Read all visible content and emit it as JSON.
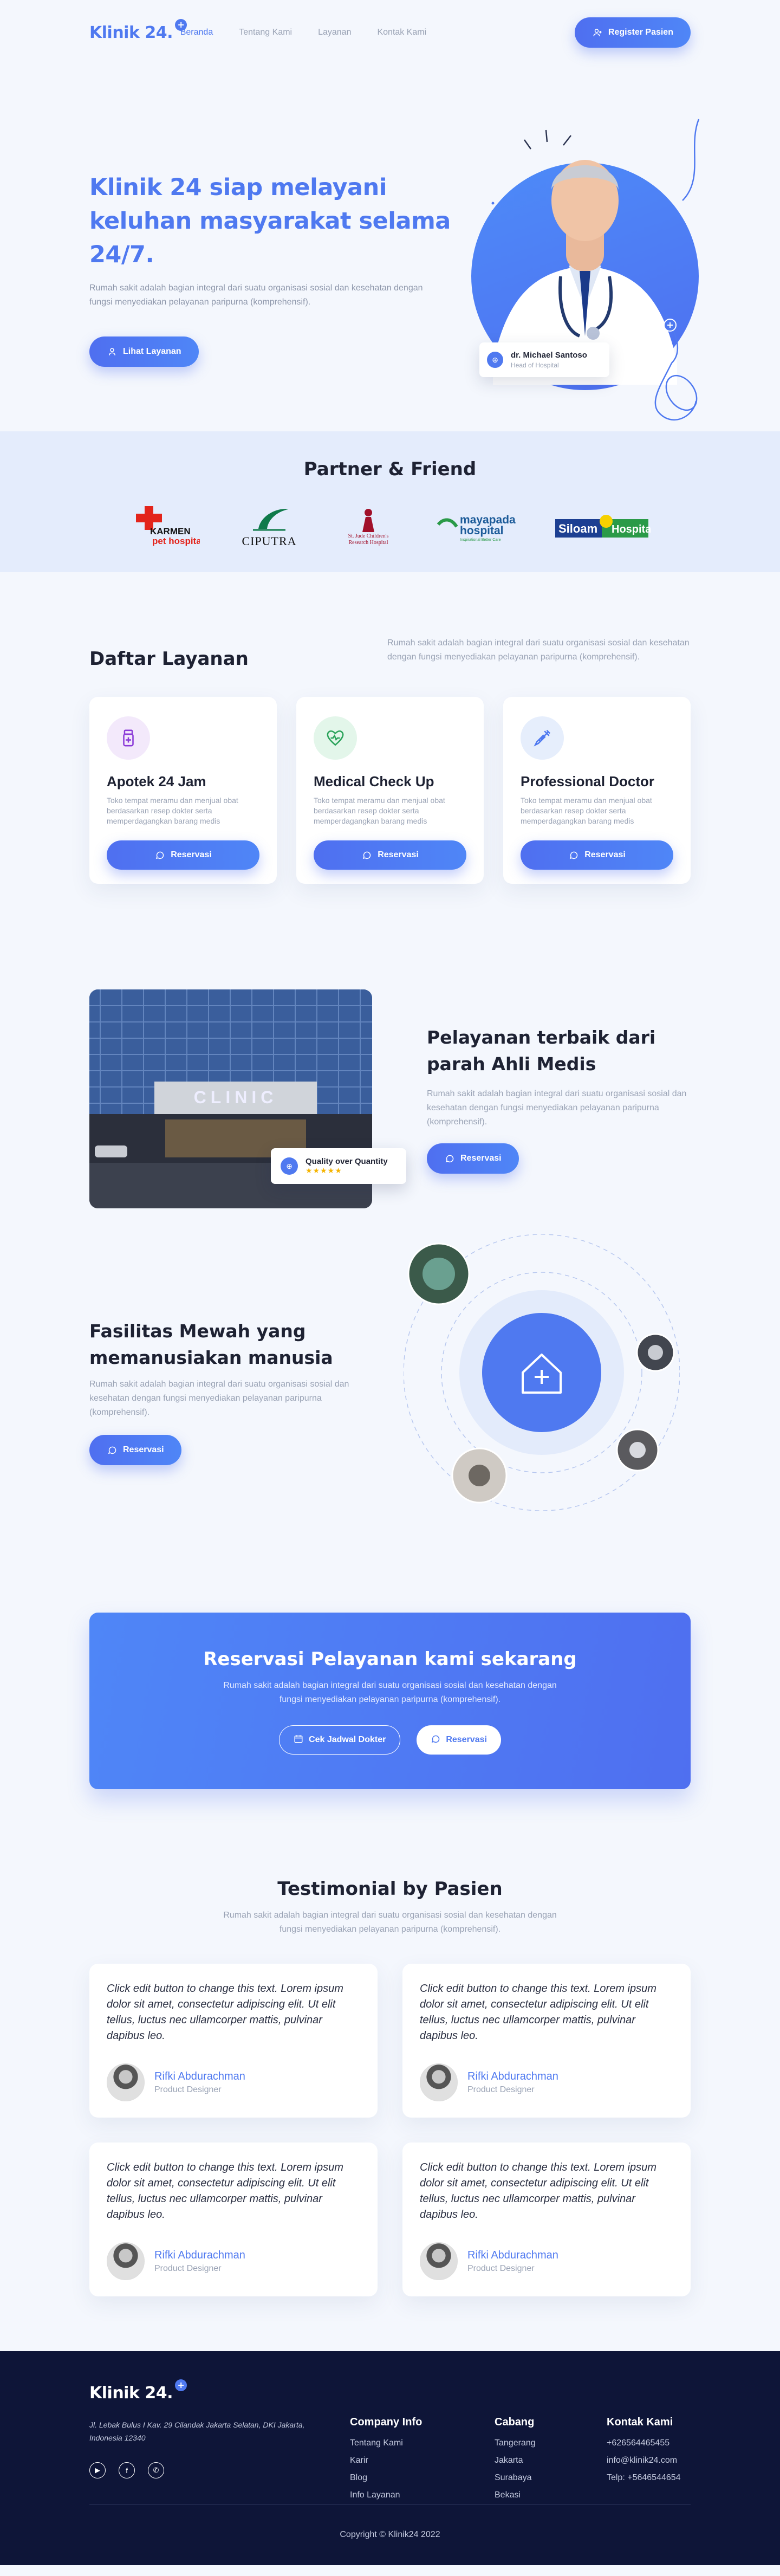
{
  "nav": {
    "logo": "Klinik 24.",
    "links": [
      "Beranda",
      "Tentang Kami",
      "Layanan",
      "Kontak Kami"
    ],
    "cta": "Register Pasien"
  },
  "hero": {
    "title": "Klinik 24 siap melayani keluhan masyarakat selama 24/7.",
    "desc": "Rumah sakit adalah bagian integral dari suatu organisasi sosial dan kesehatan dengan fungsi menyediakan pelayanan paripurna (komprehensif).",
    "cta": "Lihat Layanan",
    "doctor_name": "dr. Michael Santoso",
    "doctor_role": "Head of Hospital"
  },
  "partner": {
    "title": "Partner & Friend",
    "logos": [
      "KARMEN pet hospital",
      "CIPUTRA",
      "St. Jude Children's Research Hospital",
      "mayapada hospital",
      "Siloam Hospitals"
    ]
  },
  "services": {
    "title": "Daftar Layanan",
    "desc": "Rumah sakit adalah bagian integral dari suatu organisasi sosial dan kesehatan dengan fungsi menyediakan pelayanan paripurna (komprehensif).",
    "cards": [
      {
        "title": "Apotek 24 Jam",
        "desc": "Toko tempat meramu dan menjual obat berdasarkan resep dokter serta memperdagangkan barang medis",
        "button": "Reservasi"
      },
      {
        "title": "Medical Check Up",
        "desc": "Toko tempat meramu dan menjual obat berdasarkan resep dokter serta memperdagangkan barang medis",
        "button": "Reservasi"
      },
      {
        "title": "Professional Doctor",
        "desc": "Toko tempat meramu dan menjual obat berdasarkan resep dokter serta memperdagangkan barang medis",
        "button": "Reservasi"
      }
    ]
  },
  "about": {
    "badge": "Quality over Quantity",
    "stars": "★★★★★",
    "title": "Pelayanan terbaik dari parah Ahli Medis",
    "desc": "Rumah sakit adalah bagian integral dari suatu organisasi sosial dan kesehatan dengan fungsi menyediakan pelayanan paripurna (komprehensif).",
    "button": "Reservasi"
  },
  "facility": {
    "title": "Fasilitas Mewah yang memanusiakan manusia",
    "desc": "Rumah sakit adalah bagian integral dari suatu organisasi sosial dan kesehatan dengan fungsi menyediakan pelayanan paripurna (komprehensif).",
    "button": "Reservasi"
  },
  "cta": {
    "title": "Reservasi Pelayanan kami sekarang",
    "desc": "Rumah sakit adalah bagian integral dari suatu organisasi sosial dan kesehatan dengan fungsi menyediakan pelayanan paripurna (komprehensif).",
    "btn_schedule": "Cek Jadwal Dokter",
    "btn_reserve": "Reservasi"
  },
  "testimonial": {
    "title": "Testimonial by Pasien",
    "desc": "Rumah sakit adalah bagian integral dari suatu organisasi sosial dan kesehatan dengan fungsi menyediakan pelayanan paripurna (komprehensif).",
    "items": [
      {
        "quote": "Click edit button to change this text. Lorem ipsum dolor sit amet, consectetur adipiscing elit. Ut elit tellus, luctus nec ullamcorper mattis, pulvinar dapibus leo.",
        "name": "Rifki Abdurachman",
        "role": "Product Designer"
      },
      {
        "quote": "Click edit button to change this text. Lorem ipsum dolor sit amet, consectetur adipiscing elit. Ut elit tellus, luctus nec ullamcorper mattis, pulvinar dapibus leo.",
        "name": "Rifki Abdurachman",
        "role": "Product Designer"
      },
      {
        "quote": "Click edit button to change this text. Lorem ipsum dolor sit amet, consectetur adipiscing elit. Ut elit tellus, luctus nec ullamcorper mattis, pulvinar dapibus leo.",
        "name": "Rifki Abdurachman",
        "role": "Product Designer"
      },
      {
        "quote": "Click edit button to change this text. Lorem ipsum dolor sit amet, consectetur adipiscing elit. Ut elit tellus, luctus nec ullamcorper mattis, pulvinar dapibus leo.",
        "name": "Rifki Abdurachman",
        "role": "Product Designer"
      }
    ]
  },
  "footer": {
    "logo": "Klinik 24.",
    "address": "Jl. Lebak Bulus I Kav. 29 Cilandak Jakarta Selatan, DKI Jakarta, Indonesia 12340",
    "company_title": "Company Info",
    "company_links": [
      "Tentang Kami",
      "Karir",
      "Blog",
      "Info Layanan"
    ],
    "branch_title": "Cabang",
    "branch_links": [
      "Tangerang",
      "Jakarta",
      "Surabaya",
      "Bekasi"
    ],
    "contact_title": "Kontak Kami",
    "contact_links": [
      "+626564465455",
      "info@klinik24.com",
      "Telp: +5646544654"
    ],
    "copyright": "Copyright © Klinik24 2022"
  },
  "colors": {
    "primary": "#4f79f0",
    "footer_bg": "#0e1538",
    "partner_bg": "#e4ecfc"
  }
}
